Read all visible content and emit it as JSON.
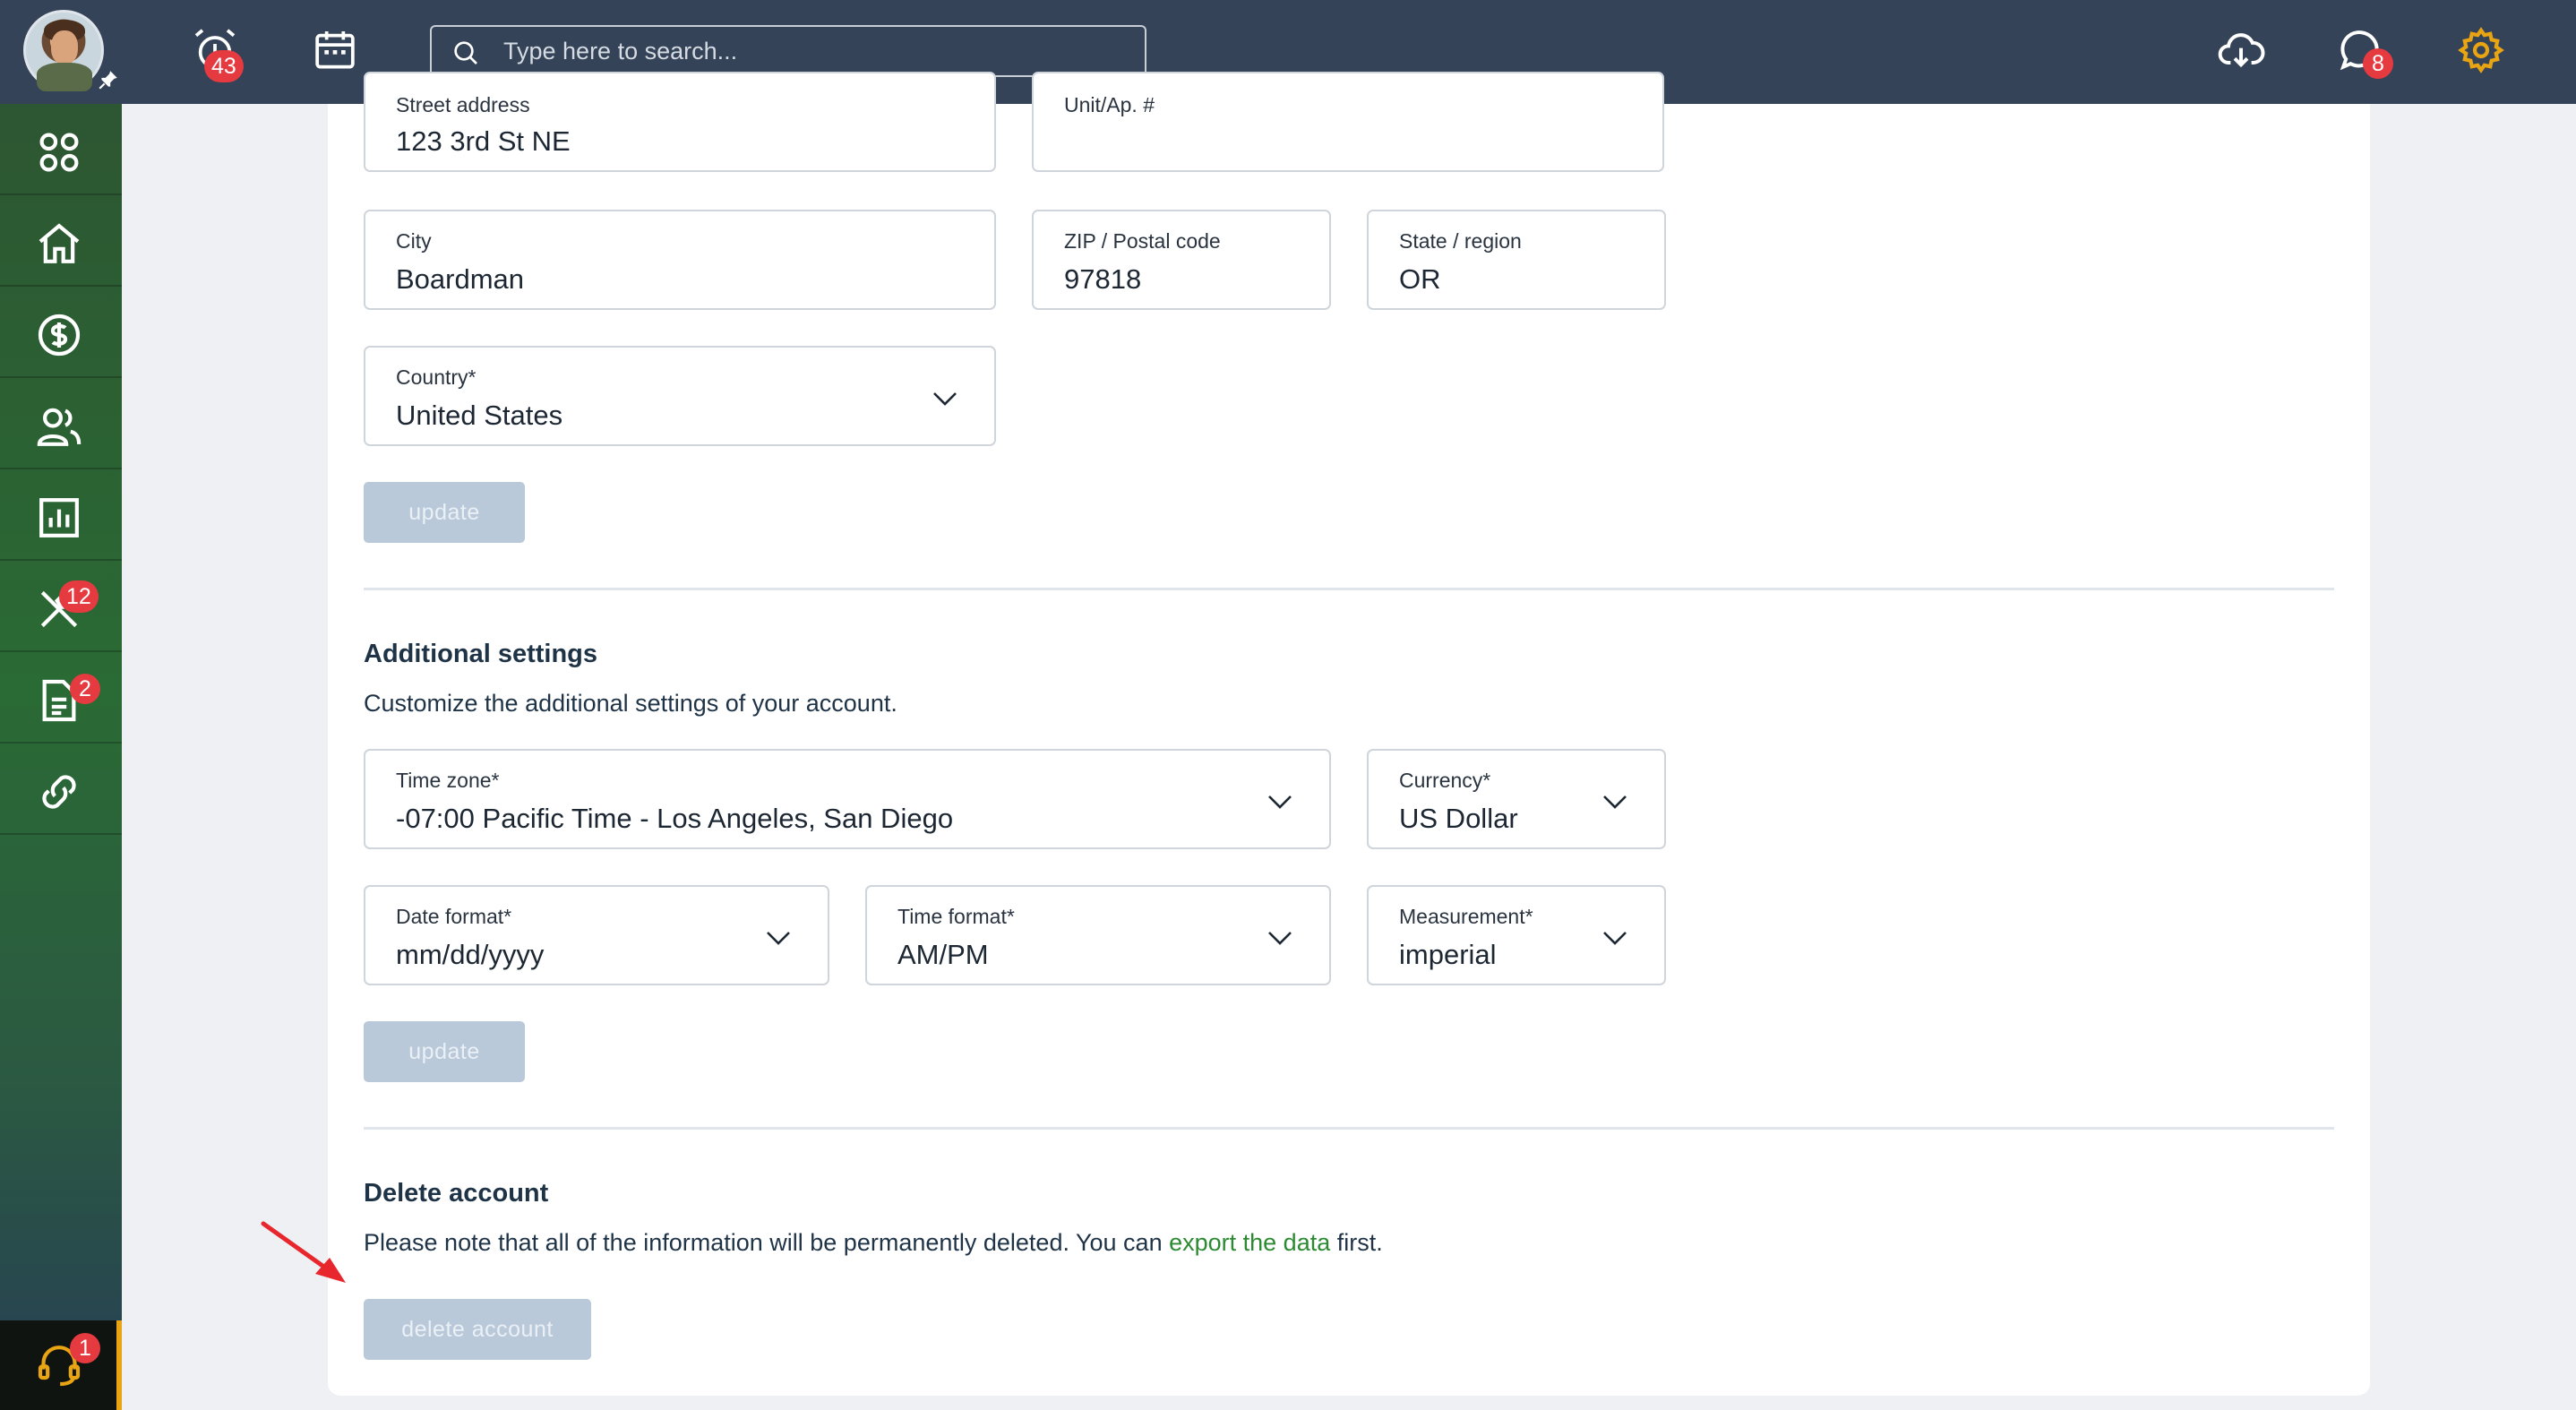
{
  "topbar": {
    "alarm_badge": "43",
    "search_placeholder": "Type here to search...",
    "chat_badge": "8"
  },
  "sidebar": {
    "tools_badge": "12",
    "docs_badge": "2",
    "support_badge": "1"
  },
  "address": {
    "street_label": "Street address",
    "street_value": "123 3rd St NE",
    "unit_label": "Unit/Ap. #",
    "unit_value": "",
    "city_label": "City",
    "city_value": "Boardman",
    "zip_label": "ZIP / Postal code",
    "zip_value": "97818",
    "state_label": "State / region",
    "state_value": "OR",
    "country_label": "Country*",
    "country_value": "United States",
    "update_label": "update"
  },
  "additional": {
    "title": "Additional settings",
    "description": "Customize the additional settings of your account.",
    "timezone_label": "Time zone*",
    "timezone_value": "-07:00 Pacific Time - Los Angeles, San Diego",
    "currency_label": "Currency*",
    "currency_value": "US Dollar",
    "date_label": "Date format*",
    "date_value": "mm/dd/yyyy",
    "time_label": "Time format*",
    "time_value": "AM/PM",
    "measure_label": "Measurement*",
    "measure_value": "imperial",
    "update_label": "update"
  },
  "delete": {
    "title": "Delete account",
    "text_before": "Please note that all of the information will be permanently deleted. You can ",
    "link": "export the data",
    "text_after": " first.",
    "button": "delete account"
  },
  "colors": {
    "topbar": "#344357",
    "accent_green": "#2c8a32",
    "badge_red": "#e53a40",
    "gear_orange": "#e8a413",
    "disabled_button": "#b9c9d9"
  }
}
